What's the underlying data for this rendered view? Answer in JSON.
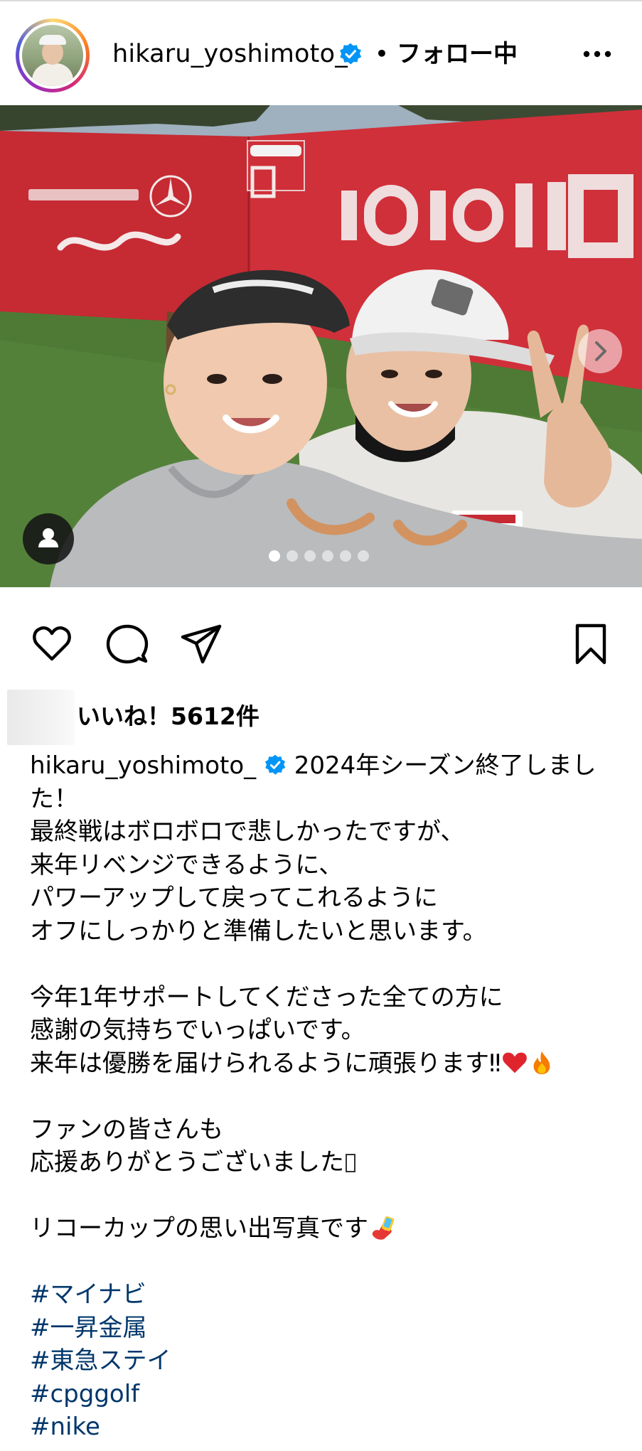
{
  "header": {
    "username": "hikaru_yoshimoto_",
    "separator": "•",
    "follow_status": "フォロー中"
  },
  "post": {
    "carousel": {
      "total": 6,
      "current": 1
    }
  },
  "likes": {
    "text": "いいね！5612件"
  },
  "caption": {
    "username": "hikaru_yoshimoto_",
    "first_line": "2024年シーズン終了しまし",
    "lines": [
      "た！",
      "最終戦はボロボロで悲しかったですが、",
      "来年リベンジできるように、",
      "パワーアップして戻ってこれるように",
      "オフにしっかりと準備したいと思います。",
      "",
      "今年1年サポートしてくださった全ての方に",
      "感謝の気持ちでいっぱいです。"
    ],
    "line_with_emoji": "来年は優勝を届けられるように頑張ります‼",
    "lines_2": [
      "",
      "ファンの皆さんも"
    ],
    "line_tofu": "応援ありがとうございました",
    "blank_3": "",
    "line_photo": "リコーカップの思い出写真です",
    "blank_4": "",
    "hashtags": [
      "#マイナビ",
      "#一昇金属",
      "#東急ステイ",
      "#cpggolf",
      "#nike"
    ]
  },
  "colors": {
    "verified_blue": "#0095f6",
    "hashtag_blue": "#00376b",
    "banner_red": "#c52b34"
  },
  "icons": {
    "more": "more-horizontal-icon",
    "like": "heart-outline-icon",
    "comment": "comment-icon",
    "share": "paper-plane-icon",
    "save": "bookmark-icon",
    "next": "chevron-right-icon",
    "tag": "user-tag-icon",
    "verified": "verified-badge-icon"
  }
}
